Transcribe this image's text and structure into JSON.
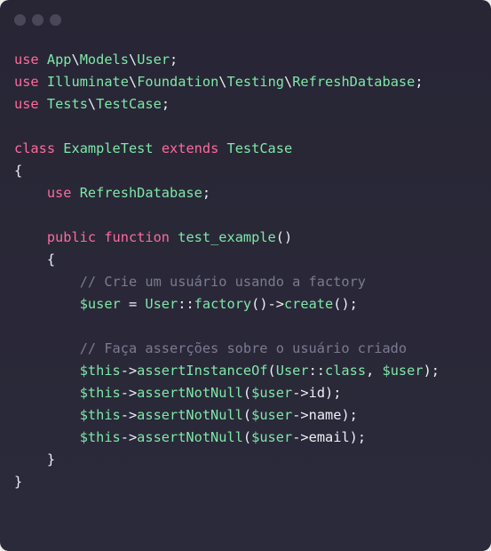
{
  "window": {
    "controls": [
      "close",
      "minimize",
      "maximize"
    ]
  },
  "colors": {
    "background": "#2a2838",
    "keyword": "#ff6a9c",
    "identifier": "#7ee8a8",
    "text": "#ecf0f5",
    "comment": "#7b7a92",
    "window_dot": "#4a4858"
  },
  "code": {
    "language": "PHP",
    "lines": [
      [
        {
          "t": "use",
          "c": "keyword"
        },
        {
          "t": " ",
          "c": "text"
        },
        {
          "t": "App",
          "c": "identifier"
        },
        {
          "t": "\\",
          "c": "text"
        },
        {
          "t": "Models",
          "c": "identifier"
        },
        {
          "t": "\\",
          "c": "text"
        },
        {
          "t": "User",
          "c": "identifier"
        },
        {
          "t": ";",
          "c": "text"
        }
      ],
      [
        {
          "t": "use",
          "c": "keyword"
        },
        {
          "t": " ",
          "c": "text"
        },
        {
          "t": "Illuminate",
          "c": "identifier"
        },
        {
          "t": "\\",
          "c": "text"
        },
        {
          "t": "Foundation",
          "c": "identifier"
        },
        {
          "t": "\\",
          "c": "text"
        },
        {
          "t": "Testing",
          "c": "identifier"
        },
        {
          "t": "\\",
          "c": "text"
        },
        {
          "t": "RefreshDatabase",
          "c": "identifier"
        },
        {
          "t": ";",
          "c": "text"
        }
      ],
      [
        {
          "t": "use",
          "c": "keyword"
        },
        {
          "t": " ",
          "c": "text"
        },
        {
          "t": "Tests",
          "c": "identifier"
        },
        {
          "t": "\\",
          "c": "text"
        },
        {
          "t": "TestCase",
          "c": "identifier"
        },
        {
          "t": ";",
          "c": "text"
        }
      ],
      [],
      [
        {
          "t": "class",
          "c": "keyword"
        },
        {
          "t": " ",
          "c": "text"
        },
        {
          "t": "ExampleTest",
          "c": "identifier"
        },
        {
          "t": " ",
          "c": "text"
        },
        {
          "t": "extends",
          "c": "keyword"
        },
        {
          "t": " ",
          "c": "text"
        },
        {
          "t": "TestCase",
          "c": "identifier"
        }
      ],
      [
        {
          "t": "{",
          "c": "text"
        }
      ],
      [
        {
          "t": "    ",
          "c": "text"
        },
        {
          "t": "use",
          "c": "keyword"
        },
        {
          "t": " ",
          "c": "text"
        },
        {
          "t": "RefreshDatabase",
          "c": "identifier"
        },
        {
          "t": ";",
          "c": "text"
        }
      ],
      [],
      [
        {
          "t": "    ",
          "c": "text"
        },
        {
          "t": "public",
          "c": "keyword"
        },
        {
          "t": " ",
          "c": "text"
        },
        {
          "t": "function",
          "c": "keyword"
        },
        {
          "t": " ",
          "c": "text"
        },
        {
          "t": "test_example",
          "c": "identifier"
        },
        {
          "t": "()",
          "c": "text"
        }
      ],
      [
        {
          "t": "    ",
          "c": "text"
        },
        {
          "t": "{",
          "c": "text"
        }
      ],
      [
        {
          "t": "        ",
          "c": "text"
        },
        {
          "t": "// Crie um usuário usando a factory",
          "c": "comment"
        }
      ],
      [
        {
          "t": "        ",
          "c": "text"
        },
        {
          "t": "$user",
          "c": "identifier"
        },
        {
          "t": " = ",
          "c": "text"
        },
        {
          "t": "User",
          "c": "identifier"
        },
        {
          "t": "::",
          "c": "text"
        },
        {
          "t": "factory",
          "c": "identifier"
        },
        {
          "t": "()->",
          "c": "text"
        },
        {
          "t": "create",
          "c": "identifier"
        },
        {
          "t": "();",
          "c": "text"
        }
      ],
      [],
      [
        {
          "t": "        ",
          "c": "text"
        },
        {
          "t": "// Faça asserções sobre o usuário criado",
          "c": "comment"
        }
      ],
      [
        {
          "t": "        ",
          "c": "text"
        },
        {
          "t": "$this",
          "c": "identifier"
        },
        {
          "t": "->",
          "c": "text"
        },
        {
          "t": "assertInstanceOf",
          "c": "identifier"
        },
        {
          "t": "(",
          "c": "text"
        },
        {
          "t": "User",
          "c": "identifier"
        },
        {
          "t": "::",
          "c": "text"
        },
        {
          "t": "class",
          "c": "identifier"
        },
        {
          "t": ", ",
          "c": "text"
        },
        {
          "t": "$user",
          "c": "identifier"
        },
        {
          "t": ");",
          "c": "text"
        }
      ],
      [
        {
          "t": "        ",
          "c": "text"
        },
        {
          "t": "$this",
          "c": "identifier"
        },
        {
          "t": "->",
          "c": "text"
        },
        {
          "t": "assertNotNull",
          "c": "identifier"
        },
        {
          "t": "(",
          "c": "text"
        },
        {
          "t": "$user",
          "c": "identifier"
        },
        {
          "t": "->id);",
          "c": "text"
        }
      ],
      [
        {
          "t": "        ",
          "c": "text"
        },
        {
          "t": "$this",
          "c": "identifier"
        },
        {
          "t": "->",
          "c": "text"
        },
        {
          "t": "assertNotNull",
          "c": "identifier"
        },
        {
          "t": "(",
          "c": "text"
        },
        {
          "t": "$user",
          "c": "identifier"
        },
        {
          "t": "->name);",
          "c": "text"
        }
      ],
      [
        {
          "t": "        ",
          "c": "text"
        },
        {
          "t": "$this",
          "c": "identifier"
        },
        {
          "t": "->",
          "c": "text"
        },
        {
          "t": "assertNotNull",
          "c": "identifier"
        },
        {
          "t": "(",
          "c": "text"
        },
        {
          "t": "$user",
          "c": "identifier"
        },
        {
          "t": "->email);",
          "c": "text"
        }
      ],
      [
        {
          "t": "    ",
          "c": "text"
        },
        {
          "t": "}",
          "c": "text"
        }
      ],
      [
        {
          "t": "}",
          "c": "text"
        }
      ]
    ]
  }
}
